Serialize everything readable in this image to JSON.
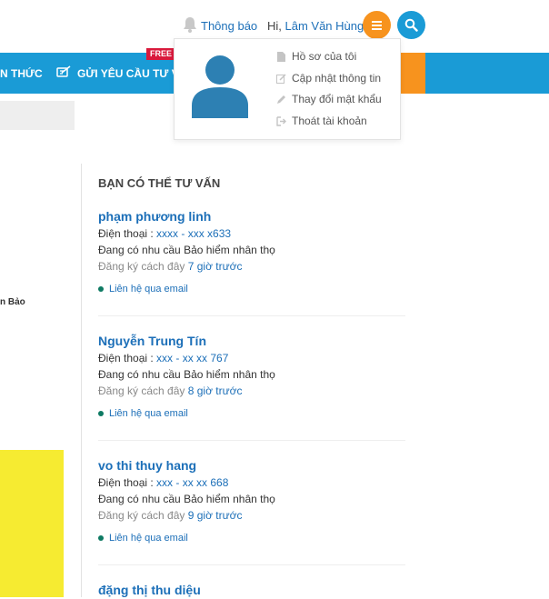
{
  "header": {
    "notifications_label": "Thông báo",
    "greeting_prefix": "Hi, ",
    "user_name": "Lâm Văn Hùng"
  },
  "nav": {
    "items": [
      {
        "label": "N THỨC"
      },
      {
        "label": "GỬI YÊU CẦU TƯ VẤN"
      }
    ],
    "free_badge": "FREE",
    "colors": {
      "primary": "#1a9bd6",
      "accent": "#f7931e"
    }
  },
  "user_menu": {
    "items": [
      {
        "label": "Hồ sơ của tôi",
        "icon": "file-icon"
      },
      {
        "label": "Cập nhật thông tin",
        "icon": "edit-icon"
      },
      {
        "label": "Thay đổi mật khẩu",
        "icon": "pencil-icon"
      },
      {
        "label": "Thoát tài khoản",
        "icon": "logout-icon"
      }
    ]
  },
  "left": {
    "fragment_text": "n Bảo"
  },
  "consult": {
    "title": "BẠN CÓ THỂ TƯ VẤN",
    "phone_label": "Điện thoại : ",
    "registered_label": "Đăng ký cách đây ",
    "contact_label": "Liên hệ qua email",
    "entries": [
      {
        "name": "phạm phương linh",
        "phone": "xxxx - xxx x633",
        "need": "Đang có nhu cầu Bảo hiểm nhân thọ",
        "time": "7 giờ trước"
      },
      {
        "name": "Nguyễn Trung Tín",
        "phone": "xxx - xx xx 767",
        "need": "Đang có nhu cầu Bảo hiểm nhân thọ",
        "time": "8 giờ trước"
      },
      {
        "name": "vo thi thuy hang",
        "phone": "xxx - xx xx 668",
        "need": "Đang có nhu cầu Bảo hiểm nhân thọ",
        "time": "9 giờ trước"
      },
      {
        "name": "đặng thị thu diệu"
      }
    ]
  }
}
